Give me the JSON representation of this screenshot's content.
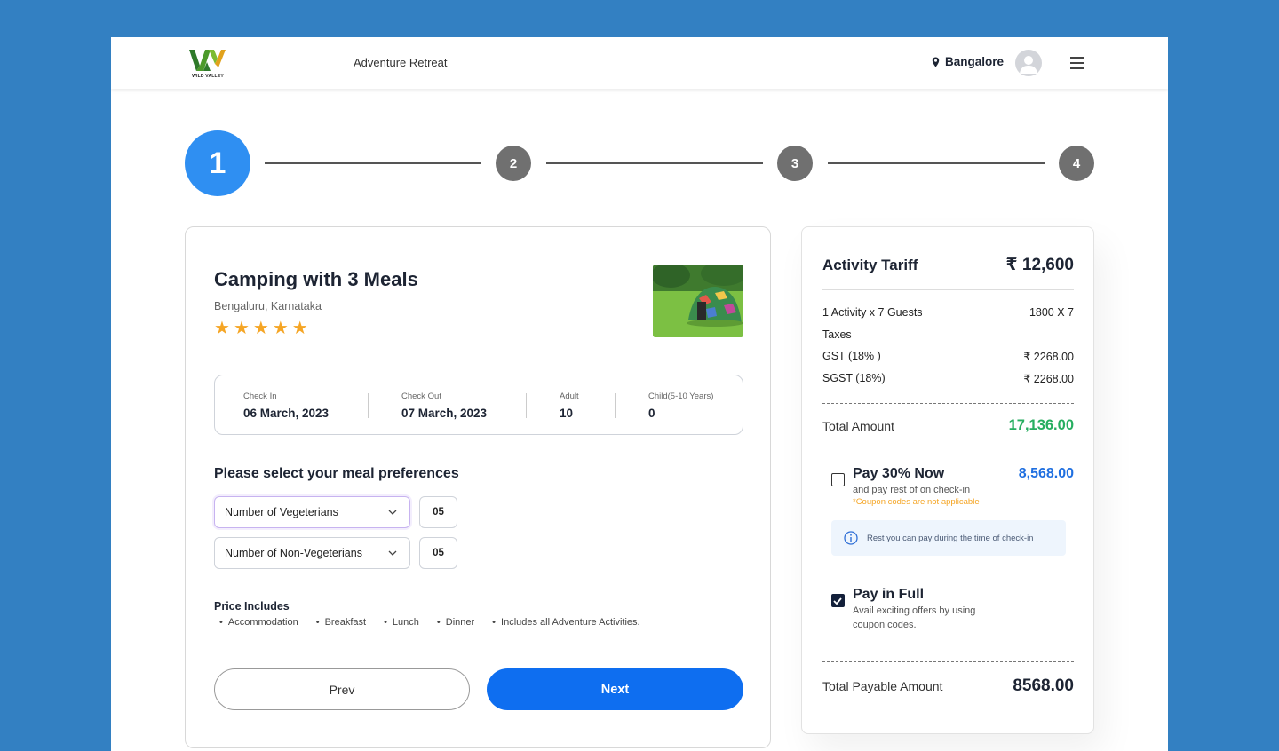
{
  "header": {
    "logo_text": "WILD VALLEY",
    "title": "Adventure Retreat",
    "location": "Bangalore",
    "icons": {
      "location": "map-pin-icon",
      "avatar": "user-avatar-icon",
      "menu": "hamburger-menu-icon"
    }
  },
  "stepper": {
    "steps": [
      "1",
      "2",
      "3",
      "4"
    ],
    "active": "1"
  },
  "activity": {
    "title": "Camping with 3 Meals",
    "location": "Bengaluru, Karnataka",
    "rating": 5,
    "image": "camping-tent-photo"
  },
  "booking": {
    "check_in_label": "Check In",
    "check_in": "06 March, 2023",
    "check_out_label": "Check Out",
    "check_out": "07 March, 2023",
    "adult_label": "Adult",
    "adult": "10",
    "child_label": "Child(5-10 Years)",
    "child": "0"
  },
  "meals": {
    "title": "Please select your meal preferences",
    "veg_label": "Number of Vegeterians",
    "veg_qty": "05",
    "nonveg_label": "Number of Non-Vegeterians",
    "nonveg_qty": "05"
  },
  "includes": {
    "title": "Price Includes",
    "items": [
      "Accommodation",
      "Breakfast",
      "Lunch",
      "Dinner",
      "Includes all Adventure Activities."
    ]
  },
  "buttons": {
    "prev": "Prev",
    "next": "Next"
  },
  "tariff": {
    "title": "Activity Tariff",
    "amount": "₹ 12,600",
    "line_label": "1 Activity x 7 Guests",
    "line_value": "1800 X 7",
    "taxes_label": "Taxes",
    "gst_label": "GST (18% )",
    "gst_value": "₹ 2268.00",
    "sgst_label": "SGST (18%)",
    "sgst_value": "₹ 2268.00",
    "total_label": "Total Amount",
    "total_value": "17,136.00",
    "partial": {
      "title": "Pay 30% Now",
      "amount": "8,568.00",
      "sub": "and pay rest of on check-in",
      "note": "*Coupon codes are not applicable",
      "info": "Rest you can pay during the time of check-in",
      "checked": false
    },
    "full": {
      "title": "Pay in Full",
      "sub1": "Avail exciting offers by using",
      "sub2": "coupon codes.",
      "checked": true
    },
    "payable_label": "Total Payable Amount",
    "payable_value": "8568.00"
  },
  "colors": {
    "background": "#3380c2",
    "accent": "#0e6ef0",
    "step_active": "#2f8ff2",
    "green": "#27ae60",
    "star": "#f5a524"
  }
}
